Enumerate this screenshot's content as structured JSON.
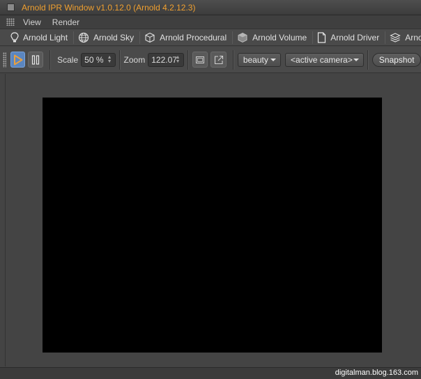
{
  "window": {
    "title": "Arnold IPR Window v1.0.12.0 (Arnold 4.2.12.3)"
  },
  "menu": {
    "items": [
      {
        "label": "View"
      },
      {
        "label": "Render"
      }
    ]
  },
  "shelf": {
    "items": [
      {
        "label": "Arnold Light",
        "icon": "bulb-icon"
      },
      {
        "label": "Arnold Sky",
        "icon": "sky-sphere-icon"
      },
      {
        "label": "Arnold Procedural",
        "icon": "procedural-cube-icon"
      },
      {
        "label": "Arnold Volume",
        "icon": "volume-cube-icon"
      },
      {
        "label": "Arnold Driver",
        "icon": "document-icon"
      },
      {
        "label": "Arnold AOV",
        "icon": "aov-layers-icon"
      }
    ]
  },
  "toolbar": {
    "scale_label": "Scale",
    "scale_value": "50 %",
    "zoom_label": "Zoom",
    "zoom_value": "122.07",
    "aov_value": "beauty",
    "camera_value": "<active camera>",
    "snapshot_label": "Snapshot"
  },
  "footer": {
    "watermark": "digitalman.blog.163.com"
  },
  "colors": {
    "title_text": "#f0a030",
    "play_accent": "#e8a040",
    "active_button": "#5b86c0"
  }
}
